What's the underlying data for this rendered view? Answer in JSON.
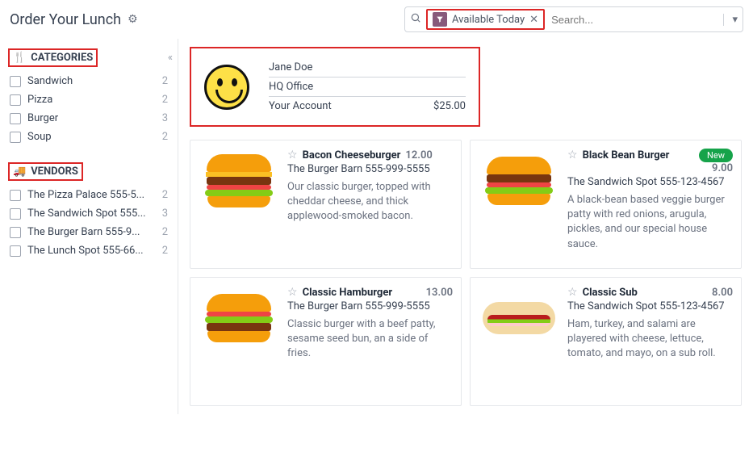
{
  "header": {
    "title": "Order Your Lunch",
    "filter_chip": "Available Today",
    "search_placeholder": "Search..."
  },
  "sidebar": {
    "categories_title": "CATEGORIES",
    "categories": [
      {
        "label": "Sandwich",
        "count": "2"
      },
      {
        "label": "Pizza",
        "count": "2"
      },
      {
        "label": "Burger",
        "count": "3"
      },
      {
        "label": "Soup",
        "count": "2"
      }
    ],
    "vendors_title": "VENDORS",
    "vendors": [
      {
        "label": "The Pizza Palace 555-5...",
        "count": "2"
      },
      {
        "label": "The Sandwich Spot 555...",
        "count": "3"
      },
      {
        "label": "The Burger Barn 555-9...",
        "count": "2"
      },
      {
        "label": "The Lunch Spot 555-66...",
        "count": "2"
      }
    ]
  },
  "account": {
    "name": "Jane Doe",
    "location": "HQ Office",
    "account_label": "Your Account",
    "balance": "$25.00"
  },
  "products": [
    {
      "name": "Bacon Cheeseburger",
      "price": "12.00",
      "vendor": "The Burger Barn 555-999-5555",
      "desc": "Our classic burger, topped with cheddar cheese, and thick applewood-smoked bacon.",
      "badge": ""
    },
    {
      "name": "Black Bean Burger",
      "price": "9.00",
      "vendor": "The Sandwich Spot 555-123-4567",
      "desc": "A black-bean based veggie burger patty with red onions, arugula, pickles, and our special house sauce.",
      "badge": "New"
    },
    {
      "name": "Classic Hamburger",
      "price": "13.00",
      "vendor": "The Burger Barn 555-999-5555",
      "desc": "Classic burger with a beef patty, sesame seed bun, an a side of fries.",
      "badge": ""
    },
    {
      "name": "Classic Sub",
      "price": "8.00",
      "vendor": "The Sandwich Spot 555-123-4567",
      "desc": "Ham, turkey, and salami are playered with cheese, lettuce, tomato, and mayo, on a sub roll.",
      "badge": ""
    }
  ]
}
